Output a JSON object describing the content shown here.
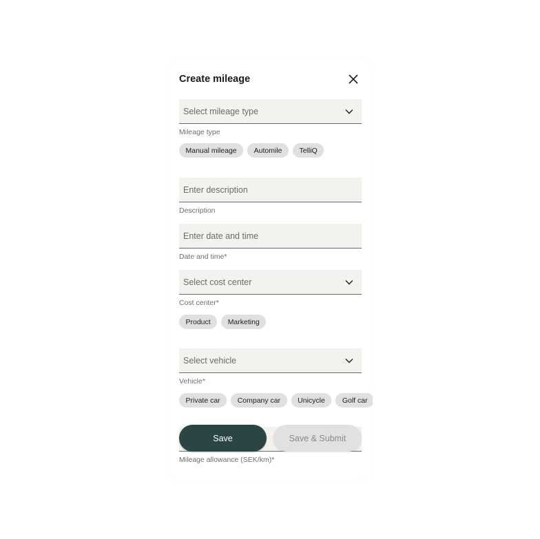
{
  "dialog": {
    "title": "Create mileage",
    "close_icon": "close-icon"
  },
  "fields": {
    "mileage_type": {
      "placeholder": "Select mileage type",
      "helper": "Mileage type",
      "chips": [
        "Manual mileage",
        "Automile",
        "TelliQ"
      ]
    },
    "description": {
      "placeholder": "Enter description",
      "helper": "Description"
    },
    "date_time": {
      "placeholder": "Enter date and time",
      "helper": "Date and time*"
    },
    "cost_center": {
      "placeholder": "Select cost center",
      "helper": "Cost center*",
      "chips": [
        "Product",
        "Marketing"
      ]
    },
    "vehicle": {
      "placeholder": "Select vehicle",
      "helper": "Vehicle*",
      "chips": [
        "Private car",
        "Company car",
        "Unicycle",
        "Golf car"
      ]
    },
    "mileage_allowance": {
      "helper": "Mileage allowance (SEK/km)*"
    }
  },
  "actions": {
    "save_label": "Save",
    "submit_label": "Save & Submit"
  },
  "colors": {
    "primary": "#2a4544",
    "input_bg": "#f3f2ee",
    "chip_bg": "#e0e0e0"
  }
}
